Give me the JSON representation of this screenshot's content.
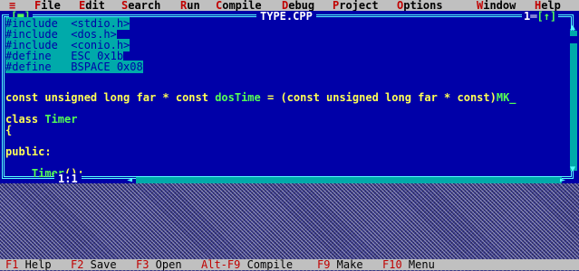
{
  "menubar": {
    "system": "≡",
    "items": [
      {
        "hot": "F",
        "rest": "ile"
      },
      {
        "hot": "E",
        "rest": "dit"
      },
      {
        "hot": "S",
        "rest": "earch"
      },
      {
        "hot": "R",
        "rest": "un"
      },
      {
        "hot": "C",
        "rest": "ompile"
      },
      {
        "hot": "D",
        "rest": "ebug"
      },
      {
        "hot": "P",
        "rest": "roject"
      },
      {
        "hot": "O",
        "rest": "ptions"
      },
      {
        "hot": "W",
        "rest": "indow"
      },
      {
        "hot": "H",
        "rest": "elp"
      }
    ]
  },
  "window": {
    "close_box": "[■]",
    "title": "TYPE.CPP",
    "number": "1",
    "zoom_box": "[↑]",
    "cursor_position": "1:1"
  },
  "code": {
    "pp": [
      "#include  <stdio.h>",
      "#include  <dos.h>",
      "#include  <conio.h>",
      "#define   ESC 0x1b",
      "#define   BSPACE 0x08"
    ],
    "l6a": "const unsigned long far * const ",
    "l6b": "dosTime",
    "l6c": " = (const unsigned long far * const)",
    "l6d": "MK_",
    "l7a": "class ",
    "l7b": "Timer",
    "l8": "{",
    "l9": "public:",
    "l10a": "    ",
    "l10b": "Timer",
    "l10c": "();"
  },
  "hintbar": [
    {
      "key": "F1",
      "label": " Help"
    },
    {
      "key": "F2",
      "label": " Save"
    },
    {
      "key": "F3",
      "label": " Open"
    },
    {
      "key": "Alt-F9",
      "label": " Compile"
    },
    {
      "key": "F9",
      "label": " Make"
    },
    {
      "key": "F10",
      "label": " Menu"
    }
  ],
  "colors": {
    "editor_bg": "#0000a8",
    "code_text": "#ffff55",
    "identifier": "#55ff55",
    "preprocessor_bg": "#00aaaa",
    "menu_bg": "#c0c0c0",
    "hotkey": "#c00000"
  }
}
